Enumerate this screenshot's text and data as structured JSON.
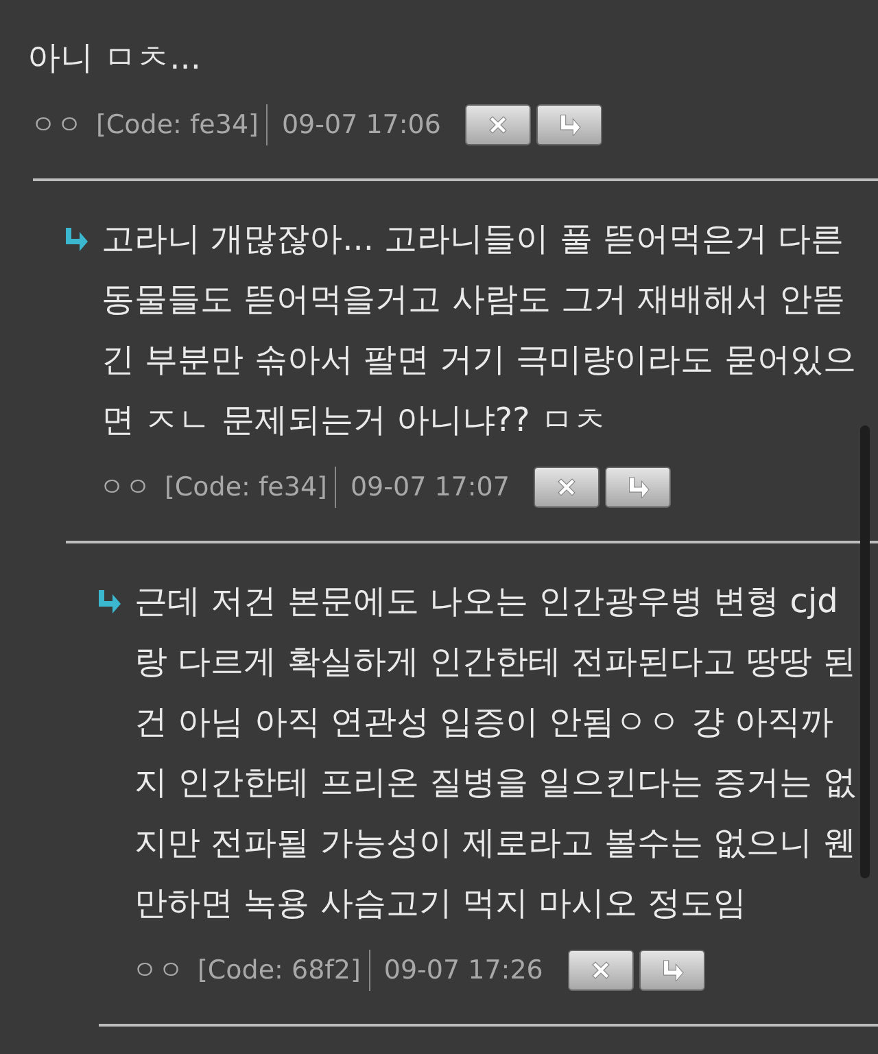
{
  "comments": [
    {
      "author": "ㅇㅇ",
      "code": "[Code: fe34]",
      "time": "09-07 17:06",
      "text": "아니 ㅁㅊ...",
      "children": [
        {
          "author": "ㅇㅇ",
          "code": "[Code: fe34]",
          "time": "09-07 17:07",
          "text": "고라니 개많잖아... 고라니들이 풀 뜯어먹은거 다른 동물들도 뜯어먹을거고 사람도 그거 재배해서 안뜯긴 부분만 솎아서 팔면 거기 극미량이라도 묻어있으면 ㅈㄴ 문제되는거 아니냐?? ㅁㅊ",
          "children": [
            {
              "author": "ㅇㅇ",
              "code": "[Code: 68f2]",
              "time": "09-07 17:26",
              "text": "근데 저건 본문에도 나오는 인간광우병 변형 cjd랑 다르게 확실하게 인간한테 전파된다고 땅땅 된건 아님 아직 연관성 입증이 안됨ㅇㅇ 걍 아직까지 인간한테 프리온 질병을 일으킨다는 증거는 없지만 전파될 가능성이 제로라고 볼수는 없으니 웬만하면 녹용 사슴고기 먹지 마시오 정도임"
            }
          ]
        }
      ]
    }
  ]
}
